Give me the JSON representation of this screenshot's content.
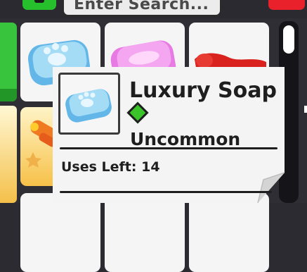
{
  "search": {
    "placeholder": "Enter Search..."
  },
  "tooltip": {
    "item_name": "Luxury Soap",
    "rarity": "Uncommon",
    "uses_left": "Uses Left: 14"
  },
  "items": [
    {
      "icon": "blue-paw-soap-icon"
    },
    {
      "icon": "pink-soap-icon"
    },
    {
      "icon": "red-toy-icon"
    },
    {
      "icon": "orange-rocket-icon"
    }
  ],
  "colors": {
    "rarity_uncommon": "#3bc42a",
    "accent_green": "#26c02c",
    "accent_red": "#e8212a"
  }
}
